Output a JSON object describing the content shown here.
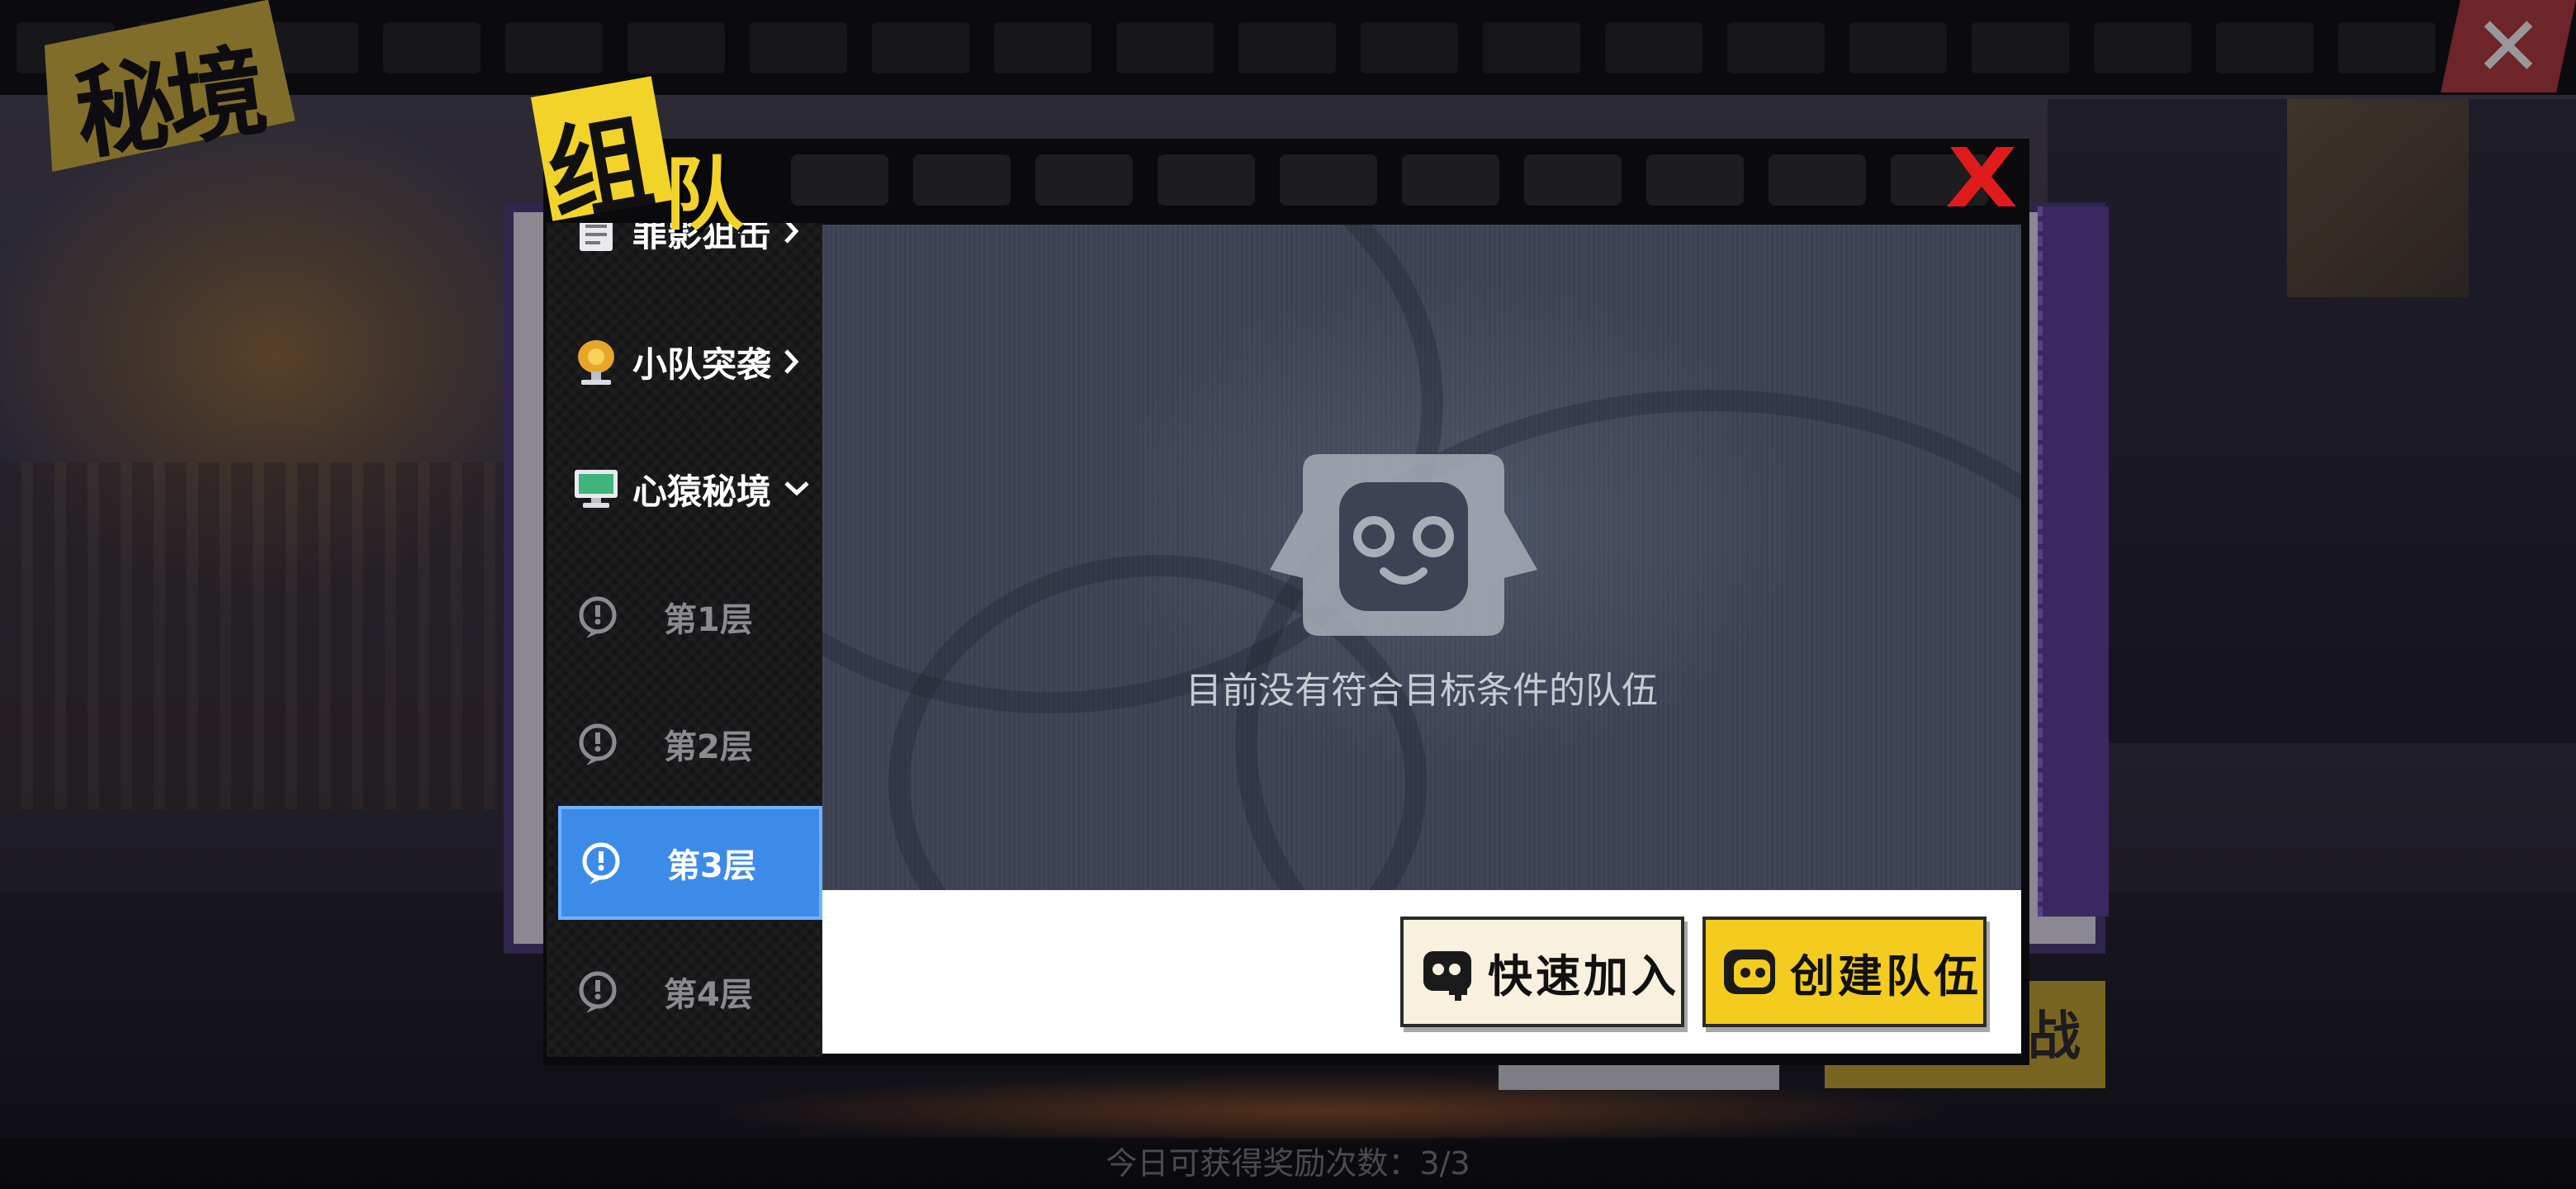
{
  "game": {
    "page_title": "秘境",
    "dialog_title_1": "组",
    "dialog_title_2": "队",
    "background_button": "挑战",
    "bottom_info": "今日可获得奖励次数：3/3"
  },
  "sidebar": {
    "categories": [
      {
        "label": "罪影狙击",
        "icon": "clipboard-icon",
        "expanded": false
      },
      {
        "label": "小队突袭",
        "icon": "gold-badge-icon",
        "expanded": false
      },
      {
        "label": "心猿秘境",
        "icon": "monitor-icon",
        "expanded": true
      }
    ],
    "floors": [
      {
        "label": "第1层",
        "active": false
      },
      {
        "label": "第2层",
        "active": false
      },
      {
        "label": "第3层",
        "active": true
      },
      {
        "label": "第4层",
        "active": false
      }
    ]
  },
  "content": {
    "empty_message": "目前没有符合目标条件的队伍",
    "empty_icon": "monkey-face-icon"
  },
  "buttons": {
    "quick_join": "快速加入",
    "create_team": "创建队伍"
  },
  "colors": {
    "accent_blue": "#3d8be8",
    "accent_yellow": "#f3cc1f",
    "close_red": "#e01b1b"
  }
}
